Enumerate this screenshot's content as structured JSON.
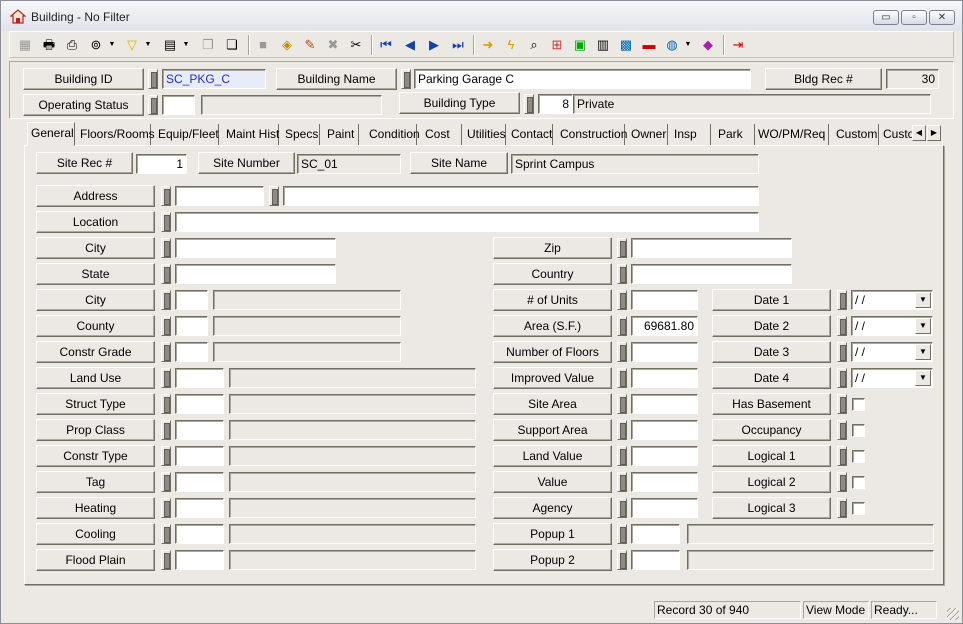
{
  "window": {
    "title": "Building - No Filter",
    "minimize": "▭",
    "maximize": "▫",
    "close": "✕"
  },
  "toolbar": {
    "icons": [
      "grid-icon",
      "print-icon",
      "print-preview-icon",
      "binoculars-icon",
      "filter-icon",
      "report-icon",
      "copy-icon",
      "paste-icon",
      "save-icon",
      "open-book-icon",
      "pencil-icon",
      "delete-icon",
      "cut-icon",
      "first-record-icon",
      "previous-record-icon",
      "next-record-icon",
      "last-record-icon",
      "arrow-right-icon",
      "lightning-icon",
      "find-icon",
      "tree-icon",
      "picture-icon",
      "calculator-icon",
      "map-icon",
      "truck-icon",
      "globe-icon",
      "book-icon",
      "exit-icon"
    ]
  },
  "header": {
    "building_id_label": "Building ID",
    "building_id_value": "SC_PKG_C",
    "building_name_label": "Building Name",
    "building_name_value": "Parking Garage C",
    "bldg_rec_label": "Bldg Rec #",
    "bldg_rec_value": "30",
    "operating_status_label": "Operating Status",
    "operating_status_code": "",
    "operating_status_desc": "",
    "building_type_label": "Building Type",
    "building_type_code": "8",
    "building_type_desc": "Private"
  },
  "tabs": [
    {
      "label": "General"
    },
    {
      "label": "Floors/Rooms"
    },
    {
      "label": "Equip/Fleet"
    },
    {
      "label": "Maint Hist"
    },
    {
      "label": "Specs"
    },
    {
      "label": "Paint"
    },
    {
      "label": "Condition"
    },
    {
      "label": "Cost"
    },
    {
      "label": "Utilities"
    },
    {
      "label": "Contact"
    },
    {
      "label": "Construction"
    },
    {
      "label": "Owner"
    },
    {
      "label": "Insp"
    },
    {
      "label": "Park"
    },
    {
      "label": "WO/PM/Req"
    },
    {
      "label": "Custom"
    },
    {
      "label": "Custo"
    }
  ],
  "general": {
    "site_rec_label": "Site Rec #",
    "site_rec_value": "1",
    "site_number_label": "Site Number",
    "site_number_value": "SC_01",
    "site_name_label": "Site Name",
    "site_name_value": "Sprint Campus",
    "left_fields": [
      {
        "label": "Address"
      },
      {
        "label": "Location"
      },
      {
        "label": "City"
      },
      {
        "label": "State"
      },
      {
        "label": "City"
      },
      {
        "label": "County"
      },
      {
        "label": "Constr Grade"
      },
      {
        "label": "Land Use"
      },
      {
        "label": "Struct Type"
      },
      {
        "label": "Prop Class"
      },
      {
        "label": "Constr Type"
      },
      {
        "label": "Tag"
      },
      {
        "label": "Heating"
      },
      {
        "label": "Cooling"
      },
      {
        "label": "Flood Plain"
      }
    ],
    "mid_fields": [
      {
        "label": "Zip",
        "value": ""
      },
      {
        "label": "Country",
        "value": ""
      },
      {
        "label": "# of Units",
        "value": ""
      },
      {
        "label": "Area (S.F.)",
        "value": "69681.80"
      },
      {
        "label": "Number of Floors",
        "value": ""
      },
      {
        "label": "Improved Value",
        "value": ""
      },
      {
        "label": "Site Area",
        "value": ""
      },
      {
        "label": "Support Area",
        "value": ""
      },
      {
        "label": "Land Value",
        "value": ""
      },
      {
        "label": "Value",
        "value": ""
      },
      {
        "label": "Agency",
        "value": ""
      },
      {
        "label": "Popup 1",
        "value": ""
      },
      {
        "label": "Popup 2",
        "value": ""
      }
    ],
    "dates": [
      {
        "label": "Date 1",
        "value": " / /"
      },
      {
        "label": "Date 2",
        "value": " / /"
      },
      {
        "label": "Date 3",
        "value": " / /"
      },
      {
        "label": "Date 4",
        "value": " / /"
      }
    ],
    "checks": [
      {
        "label": "Has Basement"
      },
      {
        "label": "Occupancy"
      },
      {
        "label": "Logical 1"
      },
      {
        "label": "Logical 2"
      },
      {
        "label": "Logical 3"
      }
    ],
    "combo_arrow": "▼"
  },
  "status": {
    "record": "Record 30 of 940",
    "mode": "View Mode",
    "state": "Ready..."
  },
  "tab_scroll": {
    "left": "◀",
    "right": "▶"
  }
}
